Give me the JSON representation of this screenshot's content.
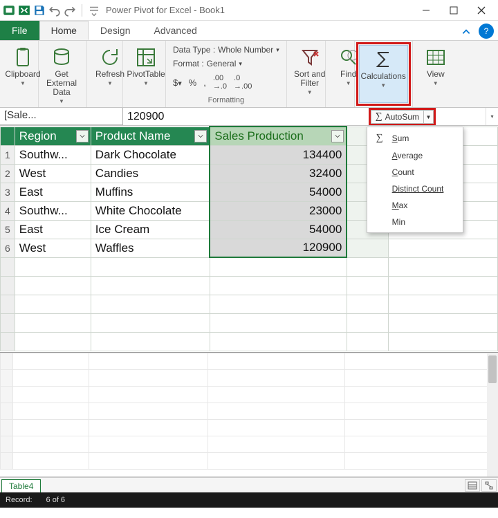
{
  "window": {
    "title": "Power Pivot for Excel - Book1"
  },
  "tabs": {
    "file": "File",
    "home": "Home",
    "design": "Design",
    "advanced": "Advanced"
  },
  "ribbon": {
    "clipboard": "Clipboard",
    "getdata": "Get External Data",
    "refresh": "Refresh",
    "pivot": "PivotTable",
    "datatype_label": "Data Type :",
    "datatype_value": "Whole Number",
    "format_label": "Format :",
    "format_value": "General",
    "formatting_group": "Formatting",
    "sortfilter": "Sort and Filter",
    "find": "Find",
    "calculations": "Calculations",
    "view": "View"
  },
  "fxbar": {
    "namebox": "[Sale...",
    "formula": "120900",
    "autosum": "AutoSum"
  },
  "autosum_menu": [
    "Sum",
    "Average",
    "Count",
    "Distinct Count",
    "Max",
    "Min"
  ],
  "columns": [
    "Region",
    "Product Name",
    "Sales Production"
  ],
  "rows": [
    {
      "n": "1",
      "region": "Southw...",
      "product": "Dark Chocolate",
      "sales": "134400"
    },
    {
      "n": "2",
      "region": "West",
      "product": "Candies",
      "sales": "32400"
    },
    {
      "n": "3",
      "region": "East",
      "product": "Muffins",
      "sales": "54000"
    },
    {
      "n": "4",
      "region": "Southw...",
      "product": "White Chocolate",
      "sales": "23000"
    },
    {
      "n": "5",
      "region": "East",
      "product": "Ice Cream",
      "sales": "54000"
    },
    {
      "n": "6",
      "region": "West",
      "product": "Waffles",
      "sales": "120900"
    }
  ],
  "sheet": {
    "tab": "Table4"
  },
  "status": {
    "record_label": "Record:",
    "pos": "6 of 6"
  }
}
